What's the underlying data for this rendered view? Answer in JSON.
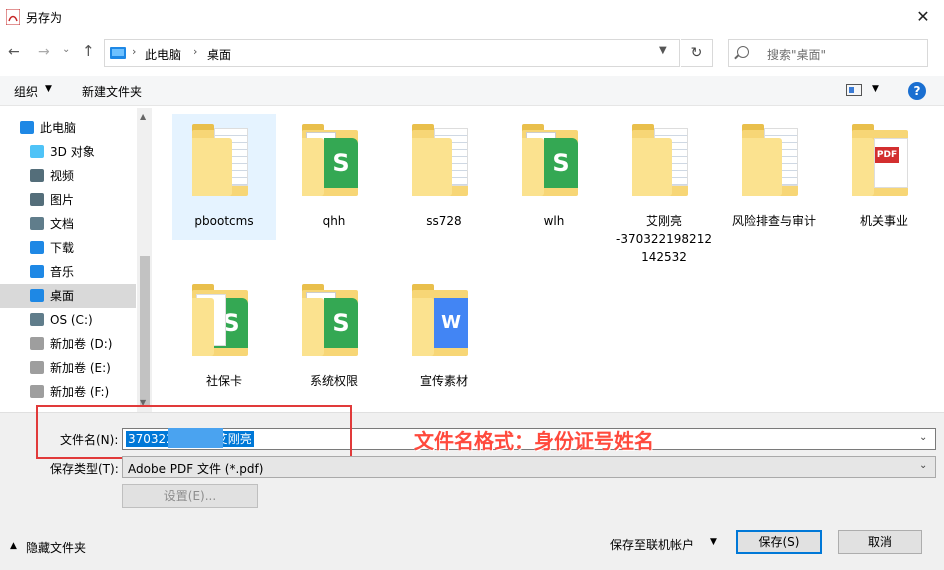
{
  "window": {
    "title": "另存为",
    "close_glyph": "✕"
  },
  "nav": {
    "back_glyph": "←",
    "forward_glyph": "→",
    "recent_glyph": "⌄",
    "up_glyph": "↑",
    "breadcrumb": [
      "此电脑",
      "桌面"
    ],
    "refresh_glyph": "↻",
    "search_placeholder": "搜索\"桌面\""
  },
  "toolbar": {
    "organize": "组织",
    "new_folder": "新建文件夹",
    "help": "?"
  },
  "sidebar": {
    "items": [
      {
        "label": "此电脑",
        "icon": "computer-icon"
      },
      {
        "label": "3D 对象",
        "icon": "cube-icon"
      },
      {
        "label": "视频",
        "icon": "video-icon"
      },
      {
        "label": "图片",
        "icon": "picture-icon"
      },
      {
        "label": "文档",
        "icon": "document-icon"
      },
      {
        "label": "下载",
        "icon": "download-icon"
      },
      {
        "label": "音乐",
        "icon": "music-icon"
      },
      {
        "label": "桌面",
        "icon": "desktop-icon",
        "selected": true
      },
      {
        "label": "OS (C:)",
        "icon": "windows-drive-icon"
      },
      {
        "label": "新加卷 (D:)",
        "icon": "drive-icon"
      },
      {
        "label": "新加卷 (E:)",
        "icon": "drive-icon"
      },
      {
        "label": "新加卷 (F:)",
        "icon": "drive-icon"
      }
    ]
  },
  "files": [
    {
      "name": "pbootcms",
      "icon": "folder-docs-icon",
      "selected": true
    },
    {
      "name": "qhh",
      "icon": "folder-spreadsheet-icon"
    },
    {
      "name": "ss728",
      "icon": "folder-docs-icon"
    },
    {
      "name": "wlh",
      "icon": "folder-spreadsheet-icon"
    },
    {
      "name": "艾刚亮\n-370322198212\n142532",
      "icon": "folder-docs-icon"
    },
    {
      "name": "风险排查与审计",
      "icon": "folder-docs-icon"
    },
    {
      "name": "机关事业",
      "icon": "folder-pdf-icon"
    },
    {
      "name": "社保卡",
      "icon": "folder-pdf-spreadsheet-icon"
    },
    {
      "name": "系统权限",
      "icon": "folder-spreadsheet-icon"
    },
    {
      "name": "宣传素材",
      "icon": "folder-word-icon"
    }
  ],
  "save_form": {
    "filename_label": "文件名(N):",
    "filename_value": "370322         32532艾刚亮",
    "type_label": "保存类型(T):",
    "type_value": "Adobe PDF 文件 (*.pdf)",
    "settings_label": "设置(E)..."
  },
  "annotation": {
    "text": "文件名格式：身份证号姓名",
    "color": "#e13a3a"
  },
  "footer": {
    "hide_folders": "隐藏文件夹",
    "save_to_account": "保存至联机帐户",
    "save": "保存(S)",
    "cancel": "取消"
  },
  "colors": {
    "accent": "#0078d7",
    "folder": "#f7d676",
    "selection": "#e5f3ff"
  }
}
